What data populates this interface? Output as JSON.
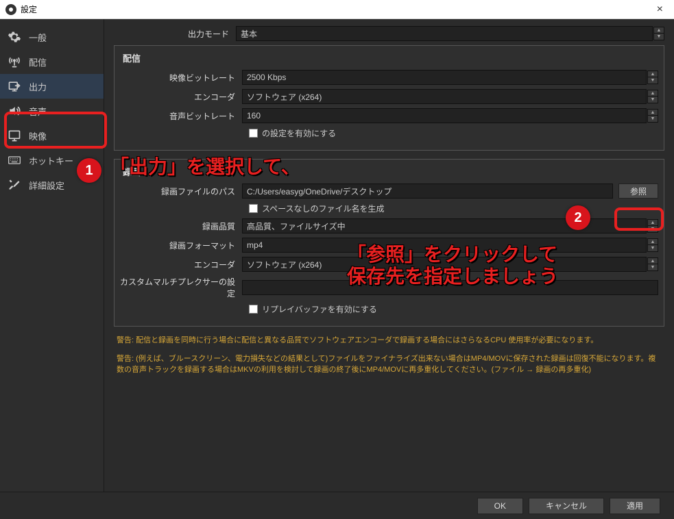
{
  "window": {
    "title": "設定",
    "close": "×"
  },
  "sidebar": {
    "items": [
      {
        "label": "一般"
      },
      {
        "label": "配信"
      },
      {
        "label": "出力"
      },
      {
        "label": "音声"
      },
      {
        "label": "映像"
      },
      {
        "label": "ホットキー"
      },
      {
        "label": "詳細設定"
      }
    ]
  },
  "output_mode": {
    "label": "出力モード",
    "value": "基本"
  },
  "stream": {
    "title": "配信",
    "bitrate": {
      "label": "映像ビットレート",
      "value": "2500 Kbps"
    },
    "encoder": {
      "label": "エンコーダ",
      "value": "ソフトウェア (x264)"
    },
    "audio_bitrate": {
      "label": "音声ビットレート",
      "value": "160"
    },
    "advanced_encoder_cb": "の設定を有効にする"
  },
  "record": {
    "title": "録画",
    "path": {
      "label": "録画ファイルのパス",
      "value": "C:/Users/easyg/OneDrive/デスクトップ",
      "browse": "参照"
    },
    "no_space_cb": "スペースなしのファイル名を生成",
    "quality": {
      "label": "録画品質",
      "value": "高品質、ファイルサイズ中"
    },
    "format": {
      "label": "録画フォーマット",
      "value": "mp4"
    },
    "encoder": {
      "label": "エンコーダ",
      "value": "ソフトウェア (x264)"
    },
    "muxer": {
      "label": "カスタムマルチプレクサーの設定",
      "value": ""
    },
    "replay_cb": "リプレイバッファを有効にする"
  },
  "warnings": [
    "警告: 配信と録画を同時に行う場合に配信と異なる品質でソフトウェアエンコーダで録画する場合にはさらなるCPU 使用率が必要になります。",
    "警告: (例えば、ブルースクリーン、電力損失などの結果として)ファイルをファイナライズ出来ない場合はMP4/MOVに保存された録画は回復不能になります。複数の音声トラックを録画する場合はMKVの利用を検討して録画の終了後にMP4/MOVに再多重化してください。(ファイル → 録画の再多重化)"
  ],
  "footer": {
    "ok": "OK",
    "cancel": "キャンセル",
    "apply": "適用"
  },
  "annotations": {
    "b1": "1",
    "b2": "2",
    "t1": "「出力」を選択して、",
    "t2a": "「参照」をクリックして",
    "t2b": "保存先を指定しましょう"
  }
}
